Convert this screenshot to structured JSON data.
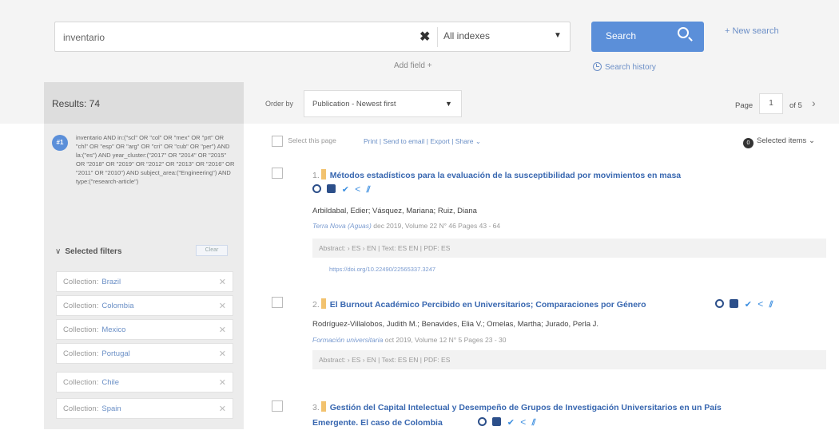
{
  "search": {
    "query": "inventario",
    "clear_symbol": "✖",
    "index": "All indexes",
    "button": "Search",
    "new_search": "+ New search",
    "add_field": "Add field +",
    "history": "Search history"
  },
  "sidebar": {
    "results_label": "Results: 74",
    "query_badge": "#1",
    "query": "inventario AND in:(\"scl\" OR \"col\" OR \"mex\" OR \"prt\" OR \"chl\" OR \"esp\" OR \"arg\" OR \"cri\" OR \"cub\" OR \"per\") AND la:(\"es\") AND year_cluster:(\"2017\" OR \"2014\" OR \"2015\" OR \"2018\" OR \"2019\" OR \"2012\" OR \"2013\" OR \"2016\" OR \"2011\" OR \"2010\") AND subject_area:(\"Engineering\") AND type:(\"research-article\")",
    "selected_filters": "Selected filters",
    "clear": "Clear",
    "filters": [
      {
        "key": "Collection:",
        "value": "Brazil"
      },
      {
        "key": "Collection:",
        "value": "Colombia"
      },
      {
        "key": "Collection:",
        "value": "Mexico"
      },
      {
        "key": "Collection:",
        "value": "Portugal"
      },
      {
        "key": "Collection:",
        "value": "Chile"
      },
      {
        "key": "Collection:",
        "value": "Spain"
      }
    ]
  },
  "results": {
    "order_by": "Order by",
    "order_value": "Publication - Newest first",
    "page_label": "Page",
    "page": "1",
    "page_of": "of 5",
    "select_page": "Select this page",
    "actions": "Print | Send to email | Export | Share ⌄",
    "selected_items": "Selected items ⌄",
    "selected_count": "0",
    "items": [
      {
        "num": "1.",
        "title": "Métodos estadísticos para la evaluación de la susceptibilidad por movimientos en masa",
        "authors": "Arbildabal, Edier; Vásquez, Mariana; Ruiz, Diana",
        "journal": "Terra Nova (Aguas)",
        "meta": "dec 2019, Volume 22  N° 46  Pages 43 - 64",
        "abstracts": "Abstract: › ES  › EN  |  Text: ES  EN  |  PDF: ES",
        "doi": "https://doi.org/10.22490/22565337.3247"
      },
      {
        "num": "2.",
        "title": "El Burnout Académico Percibido en Universitarios; Comparaciones por Género",
        "authors": "Rodríguez-Villalobos, Judith M.; Benavides, Elia V.; Ornelas, Martha; Jurado, Perla J.",
        "journal": "Formación universitaria",
        "meta": "oct 2019, Volume 12  N° 5  Pages 23 - 30",
        "abstracts": "Abstract: › ES  › EN  |  Text: ES  EN  |  PDF: ES"
      },
      {
        "num": "3.",
        "title": "Gestión del Capital Intelectual y Desempeño de Grupos de Investigación Universitarios en un País",
        "title_line2": "Emergente. El caso de Colombia"
      }
    ]
  }
}
